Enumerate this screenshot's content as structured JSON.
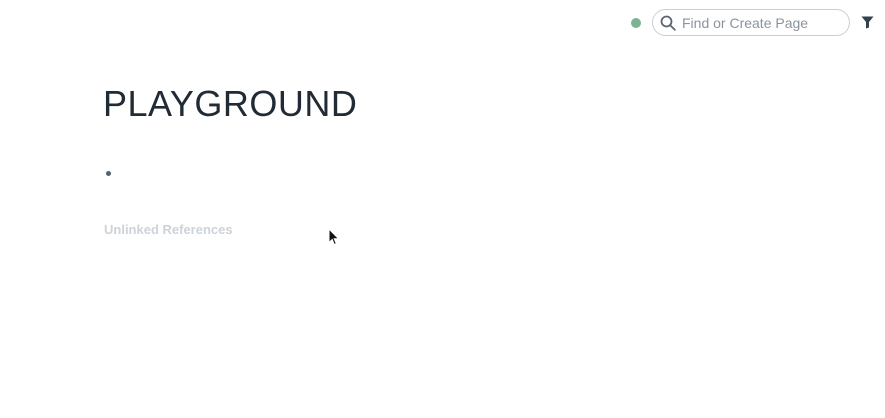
{
  "topbar": {
    "search": {
      "placeholder": "Find or Create Page",
      "value": ""
    },
    "icons": {
      "search": "search-icon",
      "filter": "filter-icon"
    },
    "status_dot_color": "#7bb38f"
  },
  "page": {
    "title": "PLAYGROUND",
    "blocks": [
      ""
    ],
    "unlinked_references_label": "Unlinked References"
  }
}
